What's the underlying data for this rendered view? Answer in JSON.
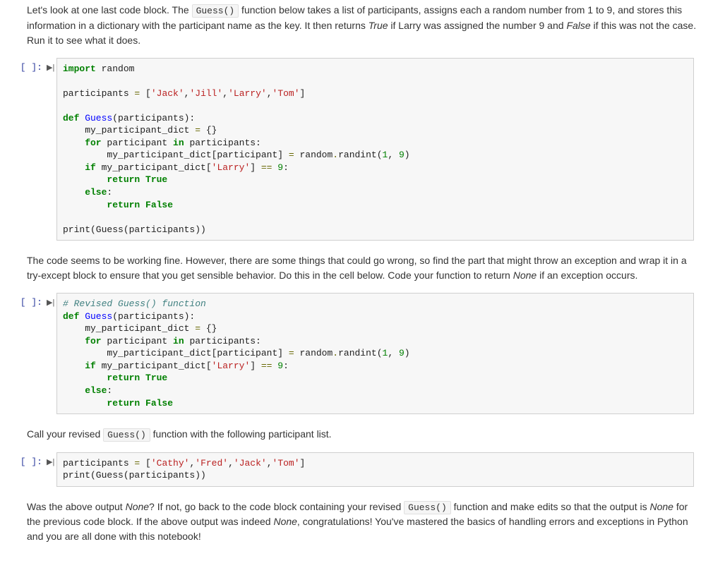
{
  "prompt_label": "[ ]:",
  "run_glyph": "▶|",
  "text1": {
    "p1a": "Let's look at one last code block. The ",
    "code1": "Guess()",
    "p1b": " function below takes a list of participants, assigns each a random number from 1 to 9, and stores this information in a dictionary with the participant name as the key. It then returns ",
    "em1": "True",
    "p1c": " if Larry was assigned the number 9 and ",
    "em2": "False",
    "p1d": " if this was not the case. Run it to see what it does."
  },
  "code1": {
    "l1_kw": "import",
    "l1_nm": " random",
    "l3_a": "participants ",
    "l3_op": "=",
    "l3_b": " [",
    "l3_s1": "'Jack'",
    "l3_c": ",",
    "l3_s2": "'Jill'",
    "l3_d": ",",
    "l3_s3": "'Larry'",
    "l3_e": ",",
    "l3_s4": "'Tom'",
    "l3_f": "]",
    "l5_kw": "def",
    "l5_fn": " Guess",
    "l5_a": "(participants):",
    "l6_a": "    my_participant_dict ",
    "l6_op": "=",
    "l6_b": " {}",
    "l7_kw": "    for",
    "l7_a": " participant ",
    "l7_kw2": "in",
    "l7_b": " participants:",
    "l8_a": "        my_participant_dict[participant] ",
    "l8_op": "=",
    "l8_b": " random",
    "l8_op2": ".",
    "l8_c": "randint(",
    "l8_n1": "1",
    "l8_d": ", ",
    "l8_n2": "9",
    "l8_e": ")",
    "l9_kw": "    if",
    "l9_a": " my_participant_dict[",
    "l9_s": "'Larry'",
    "l9_b": "] ",
    "l9_op": "==",
    "l9_c": " ",
    "l9_n": "9",
    "l9_d": ":",
    "l10_kw": "        return",
    "l10_bl": " True",
    "l11_kw": "    else",
    "l11_a": ":",
    "l12_kw": "        return",
    "l12_bl": " False",
    "l14_a": "print(Guess(participants))"
  },
  "text2": {
    "p1": "The code seems to be working fine. However, there are some things that could go wrong, so find the part that might throw an exception and wrap it in a try-except block to ensure that you get sensible behavior. Do this in the cell below. Code your function to return ",
    "em1": "None",
    "p2": " if an exception occurs."
  },
  "code2": {
    "l1_cmt": "# Revised Guess() function",
    "l2_kw": "def",
    "l2_fn": " Guess",
    "l2_a": "(participants):",
    "l3_a": "    my_participant_dict ",
    "l3_op": "=",
    "l3_b": " {}",
    "l4_kw": "    for",
    "l4_a": " participant ",
    "l4_kw2": "in",
    "l4_b": " participants:",
    "l5_a": "        my_participant_dict[participant] ",
    "l5_op": "=",
    "l5_b": " random",
    "l5_op2": ".",
    "l5_c": "randint(",
    "l5_n1": "1",
    "l5_d": ", ",
    "l5_n2": "9",
    "l5_e": ")",
    "l6_kw": "    if",
    "l6_a": " my_participant_dict[",
    "l6_s": "'Larry'",
    "l6_b": "] ",
    "l6_op": "==",
    "l6_c": " ",
    "l6_n": "9",
    "l6_d": ":",
    "l7_kw": "        return",
    "l7_bl": " True",
    "l8_kw": "    else",
    "l8_a": ":",
    "l9_kw": "        return",
    "l9_bl": " False"
  },
  "text3": {
    "p1": "Call your revised ",
    "code1": "Guess()",
    "p2": " function with the following participant list."
  },
  "code3": {
    "l1_a": "participants ",
    "l1_op": "=",
    "l1_b": " [",
    "l1_s1": "'Cathy'",
    "l1_c": ",",
    "l1_s2": "'Fred'",
    "l1_d": ",",
    "l1_s3": "'Jack'",
    "l1_e": ",",
    "l1_s4": "'Tom'",
    "l1_f": "]",
    "l2_a": "print(Guess(participants))"
  },
  "text4": {
    "p1": "Was the above output ",
    "em1": "None",
    "p2": "? If not, go back to the code block containing your revised ",
    "code1": "Guess()",
    "p3": " function and make edits so that the output is ",
    "em2": "None",
    "p4": " for the previous code block. If the above output was indeed ",
    "em3": "None",
    "p5": ", congratulations! You've mastered the basics of handling errors and exceptions in Python and you are all done with this notebook!"
  }
}
